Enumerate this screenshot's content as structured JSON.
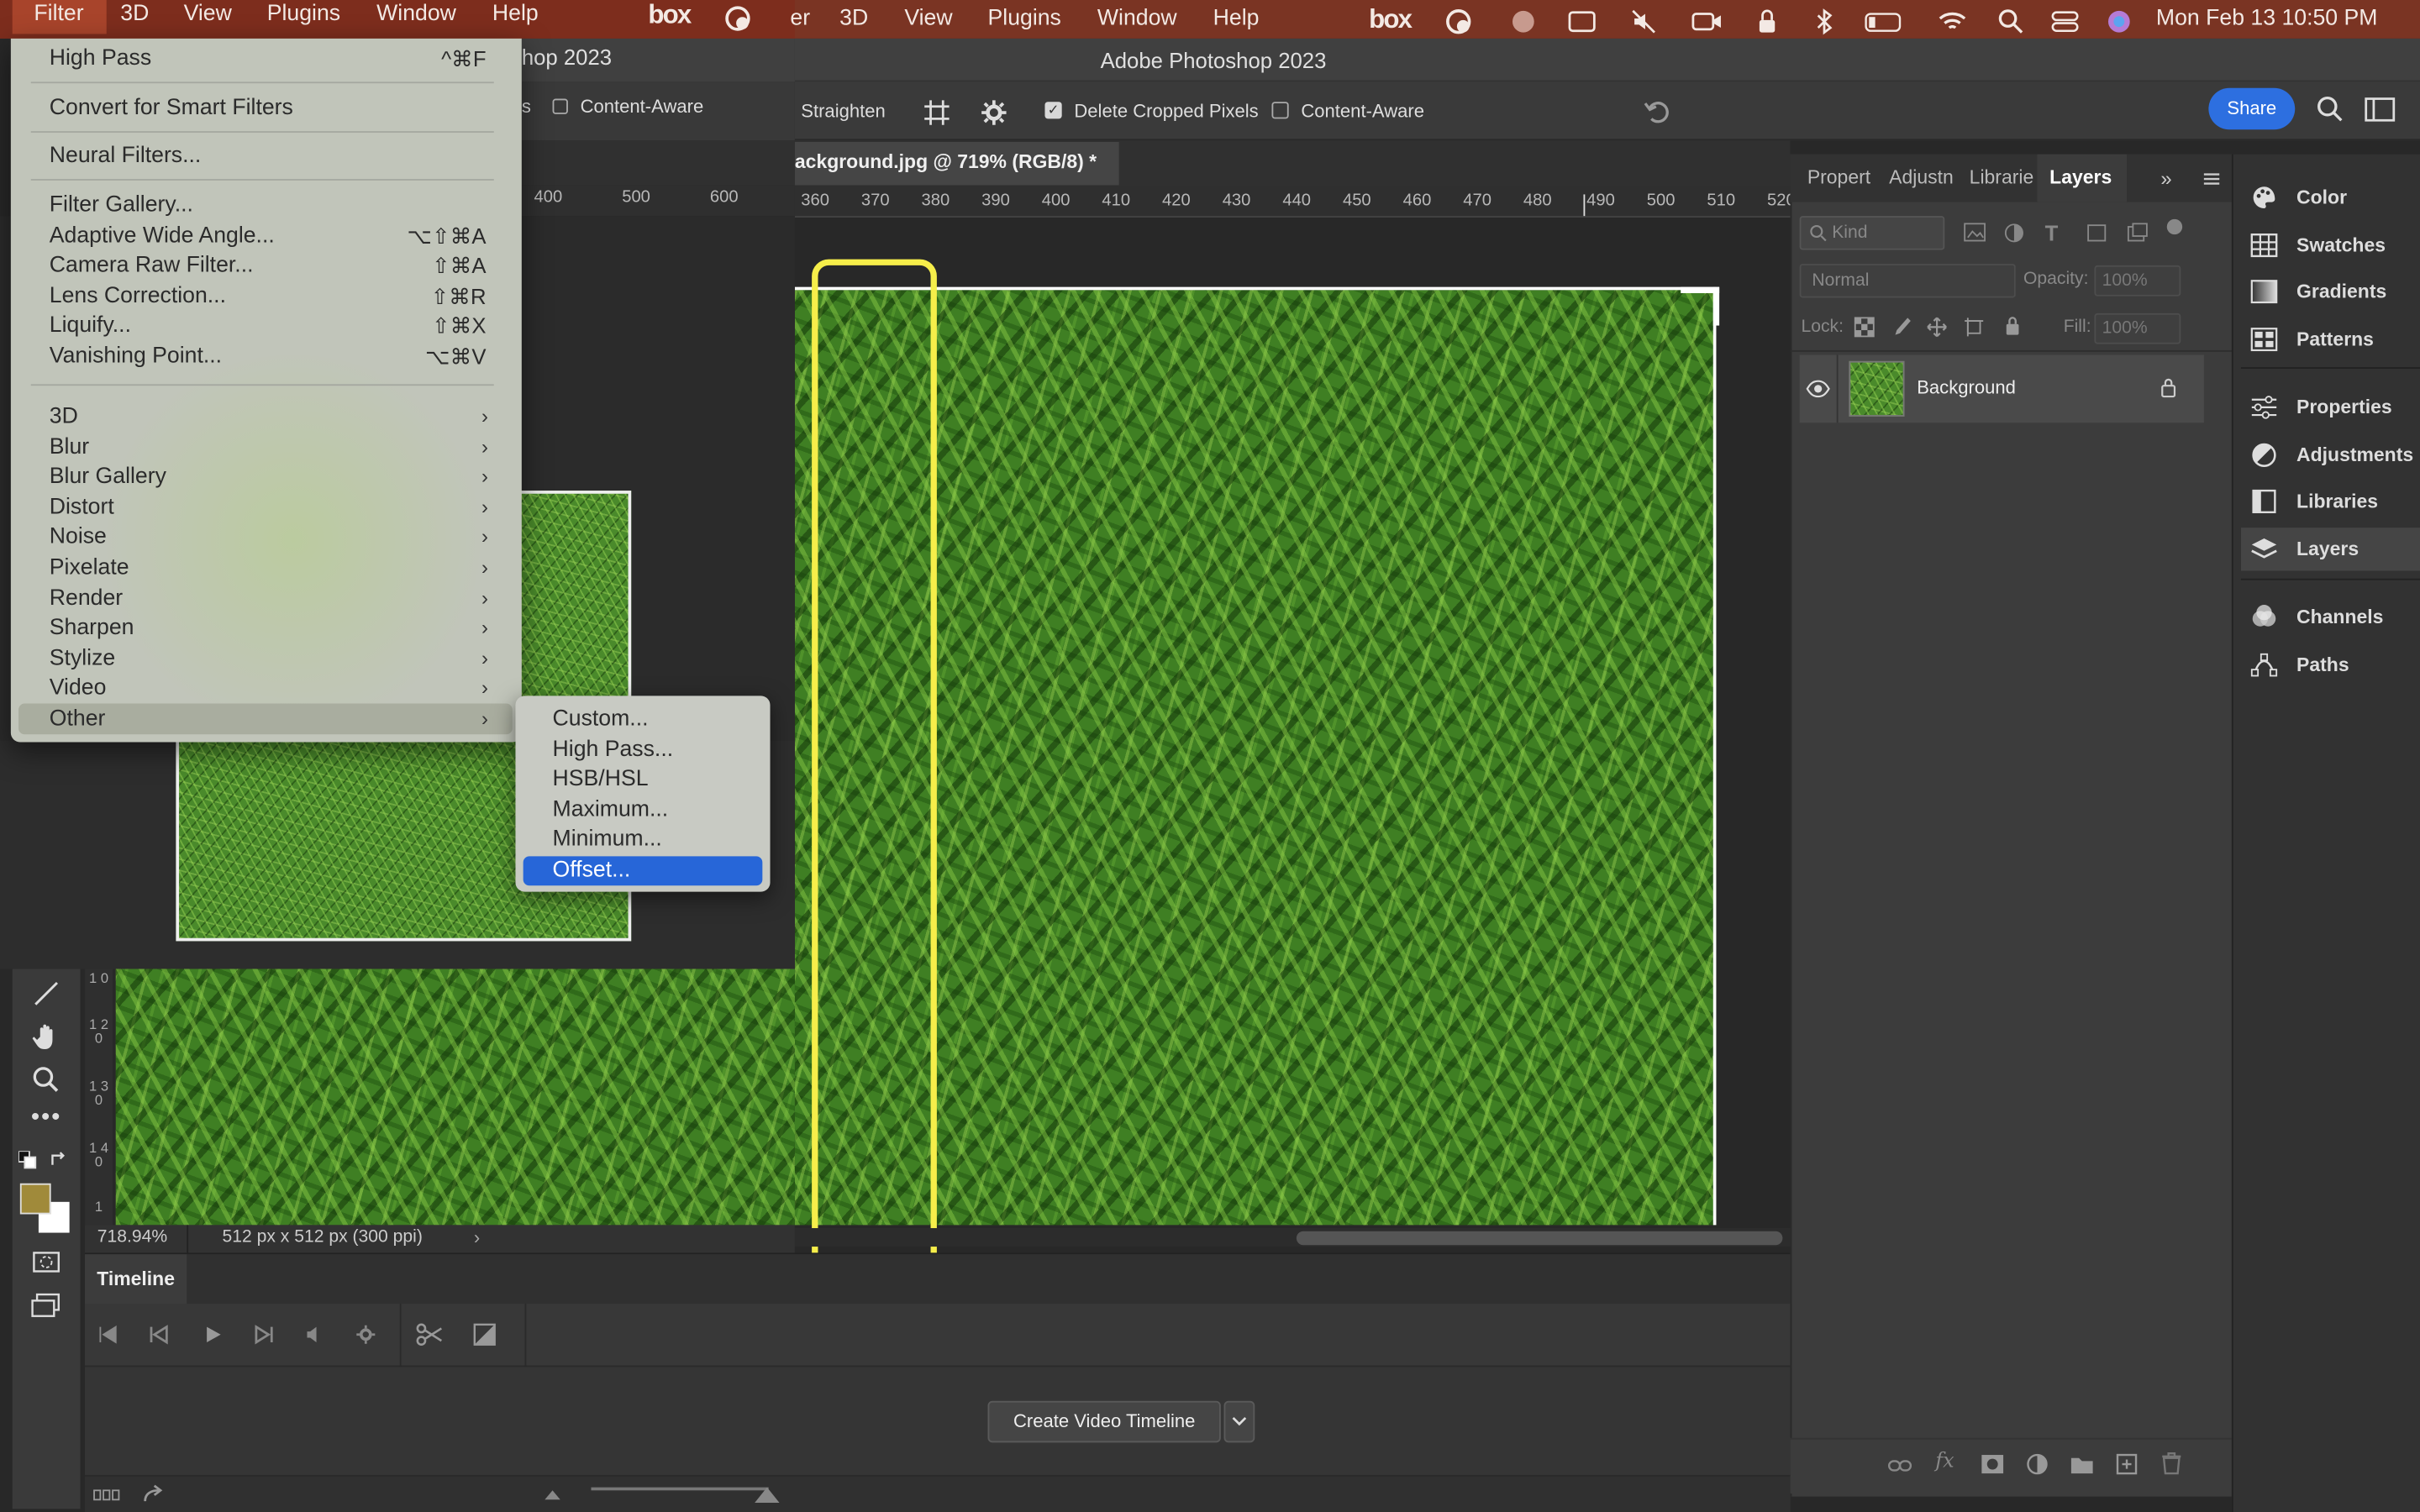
{
  "menubar": {
    "left_items": [
      "Filter",
      "3D",
      "View",
      "Plugins",
      "Window",
      "Help"
    ],
    "mid_items": [
      "er",
      "3D",
      "View",
      "Plugins",
      "Window",
      "Help"
    ],
    "box_label": "box",
    "clock": "Mon Feb 13  10:50 PM"
  },
  "app": {
    "title": "Adobe Photoshop 2023",
    "title_partial": "hop 2023",
    "doc_tab": "ackground.jpg @ 719% (RGB/8) *"
  },
  "options": {
    "straighten": "Straighten",
    "delete_cropped": "Delete Cropped Pixels",
    "content_aware": "Content-Aware",
    "partial_s": "s",
    "content_aware_left": "Content-Aware",
    "share": "Share"
  },
  "ruler": {
    "marks": [
      "360",
      "370",
      "380",
      "390",
      "400",
      "410",
      "420",
      "430",
      "440",
      "450",
      "460",
      "470",
      "480",
      "490",
      "500",
      "510",
      "520"
    ],
    "left_marks": [
      "400",
      "500",
      "600"
    ],
    "v_marks": [
      "1 0",
      "1 2 0",
      "1 3 0",
      "1 4 0",
      "1"
    ]
  },
  "status": {
    "zoom": "718.94%",
    "doc_info": "512 px x 512 px (300 ppi)"
  },
  "timeline": {
    "tab": "Timeline",
    "create_button": "Create Video Timeline"
  },
  "layers_panel": {
    "tabs": [
      "Propert",
      "Adjustn",
      "Librarie",
      "Layers"
    ],
    "kind": "Kind",
    "blend_mode": "Normal",
    "opacity_label": "Opacity:",
    "opacity_value": "100%",
    "lock_label": "Lock:",
    "fill_label": "Fill:",
    "fill_value": "100%",
    "layer_name": "Background"
  },
  "dock": {
    "items": [
      "Color",
      "Swatches",
      "Gradients",
      "Patterns",
      "Properties",
      "Adjustments",
      "Libraries",
      "Layers",
      "Channels",
      "Paths"
    ]
  },
  "filter_menu": {
    "items": [
      {
        "label": "High Pass",
        "shortcut": "^⌘F"
      },
      {
        "label": "Convert for Smart Filters",
        "shortcut": ""
      },
      {
        "label": "Neural Filters...",
        "shortcut": ""
      },
      {
        "label": "Filter Gallery...",
        "shortcut": ""
      },
      {
        "label": "Adaptive Wide Angle...",
        "shortcut": "⌥⇧⌘A"
      },
      {
        "label": "Camera Raw Filter...",
        "shortcut": "⇧⌘A"
      },
      {
        "label": "Lens Correction...",
        "shortcut": "⇧⌘R"
      },
      {
        "label": "Liquify...",
        "shortcut": "⇧⌘X"
      },
      {
        "label": "Vanishing Point...",
        "shortcut": "⌥⌘V"
      },
      {
        "label": "3D",
        "shortcut": ""
      },
      {
        "label": "Blur",
        "shortcut": ""
      },
      {
        "label": "Blur Gallery",
        "shortcut": ""
      },
      {
        "label": "Distort",
        "shortcut": ""
      },
      {
        "label": "Noise",
        "shortcut": ""
      },
      {
        "label": "Pixelate",
        "shortcut": ""
      },
      {
        "label": "Render",
        "shortcut": ""
      },
      {
        "label": "Sharpen",
        "shortcut": ""
      },
      {
        "label": "Stylize",
        "shortcut": ""
      },
      {
        "label": "Video",
        "shortcut": ""
      },
      {
        "label": "Other",
        "shortcut": ""
      }
    ],
    "submenu_arrow": "›"
  },
  "other_submenu": {
    "items": [
      "Custom...",
      "High Pass...",
      "HSB/HSL",
      "Maximum...",
      "Minimum...",
      "Offset..."
    ],
    "selected": "Offset..."
  },
  "colors": {
    "menubar": "#7a3423",
    "selection": "#2766d8",
    "highlight_box": "#f6ee4a",
    "foreground_swatch": "#a08a3a"
  }
}
